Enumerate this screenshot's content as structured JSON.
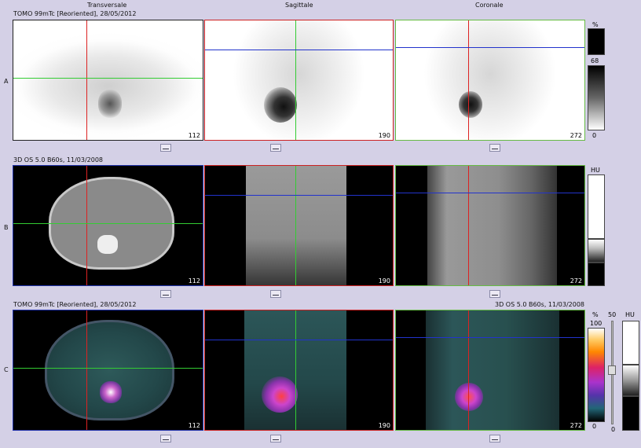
{
  "columns": {
    "transversale": "Transversale",
    "sagittale": "Sagittale",
    "coronale": "Coronale"
  },
  "rows": {
    "a": {
      "letter": "A",
      "series": "TOMO 99mTc [Reoriented], 28/05/2012"
    },
    "b": {
      "letter": "B",
      "series": "3D  OS  5.0  B60s, 11/03/2008"
    },
    "c": {
      "letter": "C",
      "series_left": "TOMO 99mTc [Reoriented], 28/05/2012",
      "series_right": "3D  OS  5.0  B60s, 11/03/2008"
    }
  },
  "slices": {
    "transverse": "112",
    "sagittal": "190",
    "coronal": "272"
  },
  "scales": {
    "nm": {
      "unit": "%",
      "level": "68",
      "min": "0"
    },
    "ct": {
      "unit": "HU"
    },
    "fusion": {
      "unit": "%",
      "max": "100",
      "min": "0",
      "blend": "50",
      "blend_min": "0",
      "ct_unit": "HU"
    }
  },
  "colors": {
    "background": "#d4d0e6",
    "nm_frame_transverse": "#000000",
    "frame_sagittal": "#cc2222",
    "frame_coronal": "#66bb44",
    "frame_ct_transverse": "#2233aa",
    "crosshair_red": "#dd2222",
    "crosshair_green": "#33cc33",
    "crosshair_blue": "#2233cc"
  }
}
